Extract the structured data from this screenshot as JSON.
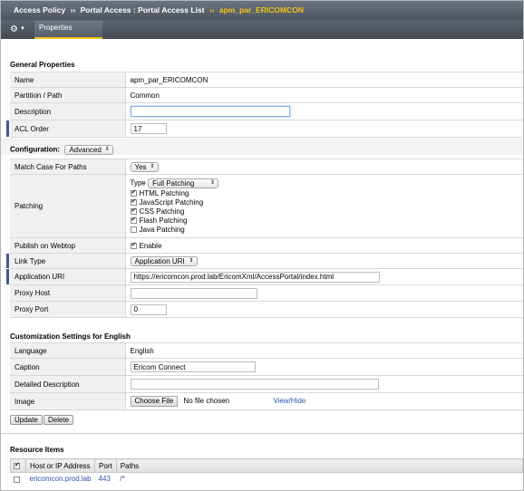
{
  "breadcrumb": {
    "items": [
      "Access Policy",
      "Portal Access : Portal Access List"
    ],
    "separator": "››",
    "current": "apm_par_ERICOMCON"
  },
  "tabs": {
    "active": "Properties"
  },
  "general": {
    "title": "General Properties",
    "name_label": "Name",
    "name_value": "apm_par_ERICOMCON",
    "partition_label": "Partition / Path",
    "partition_value": "Common",
    "description_label": "Description",
    "description_value": "",
    "acl_label": "ACL Order",
    "acl_value": "17"
  },
  "configuration": {
    "title": "Configuration:",
    "mode": "Advanced",
    "match_case_label": "Match Case For Paths",
    "match_case_value": "Yes",
    "patching_label": "Patching",
    "type_label": "Type",
    "type_value": "Full Patching",
    "patching_options": [
      {
        "label": "HTML Patching",
        "checked": true
      },
      {
        "label": "JavaScript Patching",
        "checked": true
      },
      {
        "label": "CSS Patching",
        "checked": true
      },
      {
        "label": "Flash Patching",
        "checked": true
      },
      {
        "label": "Java Patching",
        "checked": false
      }
    ],
    "publish_label": "Publish on Webtop",
    "publish_enable": "Enable",
    "link_type_label": "Link Type",
    "link_type_value": "Application URI",
    "app_uri_label": "Application URI",
    "app_uri_value": "https://ericomcon.prod.lab/EricomXml/AccessPortal/index.html",
    "proxy_host_label": "Proxy Host",
    "proxy_host_value": "",
    "proxy_port_label": "Proxy Port",
    "proxy_port_value": "0"
  },
  "customization": {
    "title": "Customization Settings for English",
    "language_label": "Language",
    "language_value": "English",
    "caption_label": "Caption",
    "caption_value": "Ericom Connect",
    "detailed_label": "Detailed Description",
    "detailed_value": "",
    "image_label": "Image",
    "choose_file": "Choose File",
    "no_file": "No file chosen",
    "view_hide": "View/Hide"
  },
  "actions": {
    "update": "Update",
    "delete": "Delete"
  },
  "resources": {
    "title": "Resource Items",
    "columns": [
      "Host or IP Address",
      "Port",
      "Paths"
    ],
    "rows": [
      {
        "host": "ericomcon.prod.lab",
        "port": "443",
        "paths": "/*"
      }
    ]
  },
  "colors": {
    "accent": "#f0c419",
    "header": "#4d5560",
    "link": "#2a55a8",
    "required_bar": "#3b5a85"
  }
}
